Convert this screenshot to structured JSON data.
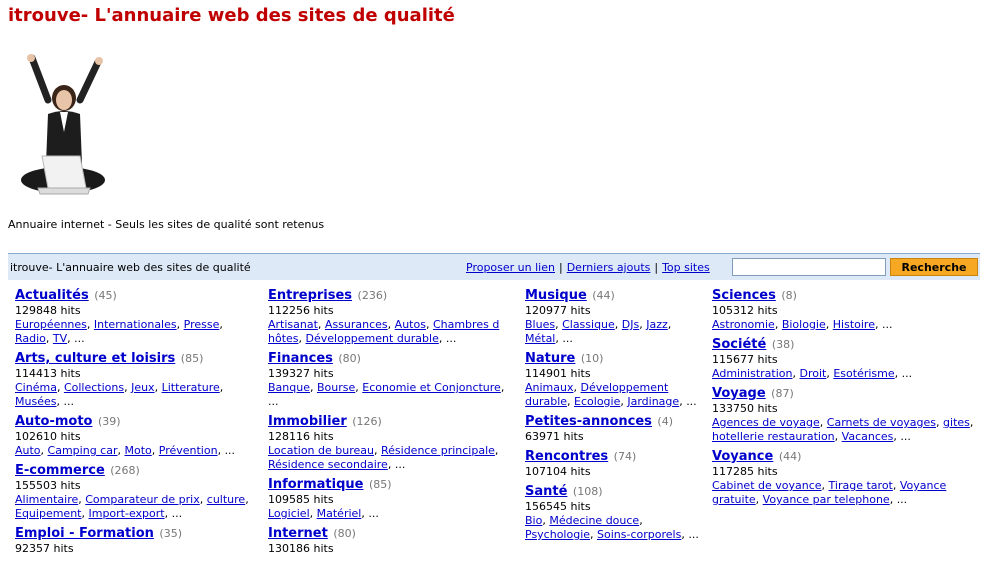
{
  "header": {
    "title": "itrouve- L'annuaire web des sites de qualité",
    "tagline": "Annuaire internet - Seuls les sites de qualité sont retenus"
  },
  "hero": {
    "icon": "woman-laptop-arms-raised"
  },
  "bar": {
    "title": "itrouve- L'annuaire web des sites de qualité",
    "links": [
      "Proposer un lien",
      "Derniers ajouts",
      "Top sites"
    ],
    "search_placeholder": "",
    "search_button": "Recherche"
  },
  "columns": [
    [
      {
        "name": "Actualités",
        "count": "(45)",
        "hits": "129848 hits",
        "subs": [
          "Européennes",
          "Internationales",
          "Presse",
          "Radio",
          "TV"
        ]
      },
      {
        "name": "Arts, culture et loisirs",
        "count": "(85)",
        "hits": "114413 hits",
        "subs": [
          "Cinéma",
          "Collections",
          "Jeux",
          "Litterature",
          "Musées"
        ]
      },
      {
        "name": "Auto-moto",
        "count": "(39)",
        "hits": "102610 hits",
        "subs": [
          "Auto",
          "Camping car",
          "Moto",
          "Prévention"
        ]
      },
      {
        "name": "E-commerce",
        "count": "(268)",
        "hits": "155503 hits",
        "subs": [
          "Alimentaire",
          "Comparateur de prix",
          "culture",
          "Equipement",
          "Import-export"
        ]
      },
      {
        "name": "Emploi - Formation",
        "count": "(35)",
        "hits": "92357 hits",
        "subs": []
      }
    ],
    [
      {
        "name": "Entreprises",
        "count": "(236)",
        "hits": "112256 hits",
        "subs": [
          "Artisanat",
          "Assurances",
          "Autos",
          "Chambres d hôtes",
          "Développement durable"
        ]
      },
      {
        "name": "Finances",
        "count": "(80)",
        "hits": "139327 hits",
        "subs": [
          "Banque",
          "Bourse",
          "Economie et Conjoncture"
        ]
      },
      {
        "name": "Immobilier",
        "count": "(126)",
        "hits": "128116 hits",
        "subs": [
          "Location de bureau",
          "Résidence principale",
          "Résidence secondaire"
        ]
      },
      {
        "name": "Informatique",
        "count": "(85)",
        "hits": "109585 hits",
        "subs": [
          "Logiciel",
          "Matériel"
        ]
      },
      {
        "name": "Internet",
        "count": "(80)",
        "hits": "130186 hits",
        "subs": []
      }
    ],
    [
      {
        "name": "Musique",
        "count": "(44)",
        "hits": "120977 hits",
        "subs": [
          "Blues",
          "Classique",
          "DJs",
          "Jazz",
          "Métal"
        ]
      },
      {
        "name": "Nature",
        "count": "(10)",
        "hits": "114901 hits",
        "subs": [
          "Animaux",
          "Développement durable",
          "Ecologie",
          "Jardinage"
        ]
      },
      {
        "name": "Petites-annonces",
        "count": "(4)",
        "hits": "63971 hits",
        "subs": []
      },
      {
        "name": "Rencontres",
        "count": "(74)",
        "hits": "107104 hits",
        "subs": []
      },
      {
        "name": "Santé",
        "count": "(108)",
        "hits": "156545 hits",
        "subs": [
          "Bio",
          "Médecine douce",
          "Psychologie",
          "Soins-corporels"
        ]
      }
    ],
    [
      {
        "name": "Sciences",
        "count": "(8)",
        "hits": "105312 hits",
        "subs": [
          "Astronomie",
          "Biologie",
          "Histoire"
        ]
      },
      {
        "name": "Société",
        "count": "(38)",
        "hits": "115677 hits",
        "subs": [
          "Administration",
          "Droit",
          "Esotérisme"
        ]
      },
      {
        "name": "Voyage",
        "count": "(87)",
        "hits": "133750 hits",
        "subs": [
          "Agences de voyage",
          "Carnets de voyages",
          "gites",
          "hotellerie restauration",
          "Vacances"
        ]
      },
      {
        "name": "Voyance",
        "count": "(44)",
        "hits": "117285 hits",
        "subs": [
          "Cabinet de voyance",
          "Tirage tarot",
          "Voyance gratuite",
          "Voyance par telephone"
        ]
      }
    ]
  ],
  "ellipsis": "..."
}
